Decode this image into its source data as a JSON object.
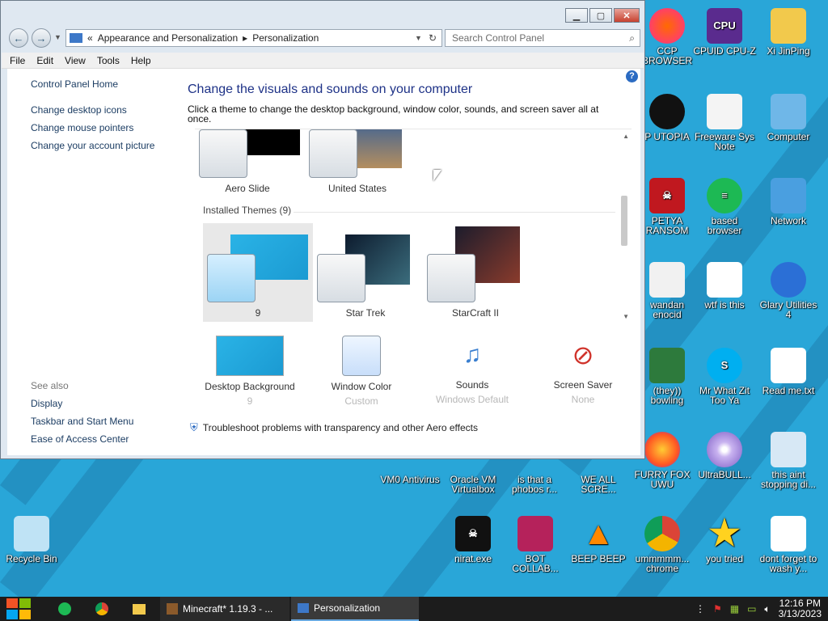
{
  "window": {
    "breadcrumb_sep": "«",
    "breadcrumb": [
      "Appearance and Personalization",
      "Personalization"
    ],
    "search_placeholder": "Search Control Panel",
    "menu": [
      "File",
      "Edit",
      "View",
      "Tools",
      "Help"
    ]
  },
  "leftpane": {
    "links": [
      "Control Panel Home",
      "Change desktop icons",
      "Change mouse pointers",
      "Change your account picture"
    ],
    "see_also_label": "See also",
    "see_also": [
      "Display",
      "Taskbar and Start Menu",
      "Ease of Access Center"
    ]
  },
  "main": {
    "title": "Change the visuals and sounds on your computer",
    "subtitle": "Click a theme to change the desktop background, window color, sounds, and screen saver all at once.",
    "themes_top": [
      "Aero Slide",
      "United States"
    ],
    "installed_label": "Installed Themes (9)",
    "installed": [
      "9",
      "Star Trek",
      "StarCraft II"
    ],
    "bottom": [
      {
        "label": "Desktop Background",
        "value": "9"
      },
      {
        "label": "Window Color",
        "value": "Custom"
      },
      {
        "label": "Sounds",
        "value": "Windows Default"
      },
      {
        "label": "Screen Saver",
        "value": "None"
      }
    ],
    "troubleshoot": "Troubleshoot problems with transparency and other Aero effects"
  },
  "desktop": {
    "icons": [
      {
        "label": "CCP BROWSER"
      },
      {
        "label": "CPUID CPU-Z"
      },
      {
        "label": "Xi JinPing"
      },
      {
        "label": "P UTOPIA"
      },
      {
        "label": "Freeware Sys Note"
      },
      {
        "label": "Computer"
      },
      {
        "label": "PETYA RANSOM"
      },
      {
        "label": "based browser"
      },
      {
        "label": "Network"
      },
      {
        "label": "wandan enocid"
      },
      {
        "label": "wtf is this"
      },
      {
        "label": "Glary Utilities 4"
      },
      {
        "label": "(they)) bowling"
      },
      {
        "label": "Mr What Zit Too Ya"
      },
      {
        "label": "Read me.txt"
      },
      {
        "label": "VM0 Antivirus"
      },
      {
        "label": "Oracle VM Virtualbox"
      },
      {
        "label": "is that a phobos r..."
      },
      {
        "label": "WE ALL SCRE..."
      },
      {
        "label": "FURRY FOX UWU"
      },
      {
        "label": "UltraBULL..."
      },
      {
        "label": "this aint stopping di..."
      },
      {
        "label": "Recycle Bin"
      },
      {
        "label": "nirat.exe"
      },
      {
        "label": "BOT COLLAB..."
      },
      {
        "label": "BEEP BEEP"
      },
      {
        "label": "ummmmm... chrome"
      },
      {
        "label": "you tried"
      },
      {
        "label": "dont forget to wash y..."
      }
    ]
  },
  "taskbar": {
    "items": [
      "Minecraft* 1.19.3 - ...",
      "Personalization"
    ],
    "time": "12:16 PM",
    "date": "3/13/2023"
  }
}
